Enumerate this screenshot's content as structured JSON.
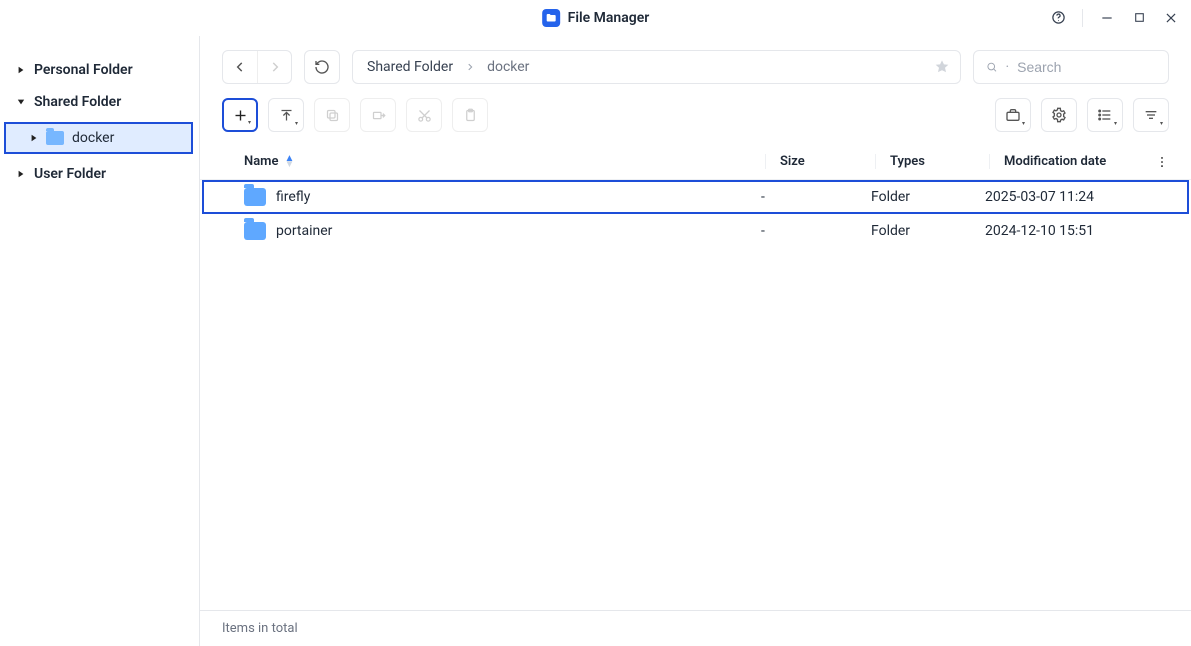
{
  "app": {
    "title": "File Manager"
  },
  "sidebar": {
    "items": [
      {
        "label": "Personal Folder",
        "expanded": false
      },
      {
        "label": "Shared Folder",
        "expanded": true,
        "children": [
          {
            "label": "docker",
            "selected": true
          }
        ]
      },
      {
        "label": "User Folder",
        "expanded": false
      }
    ]
  },
  "breadcrumb": {
    "segments": [
      "Shared Folder",
      "docker"
    ]
  },
  "search": {
    "placeholder": "Search"
  },
  "columns": {
    "name": "Name",
    "size": "Size",
    "types": "Types",
    "mod": "Modification date"
  },
  "rows": [
    {
      "name": "firefly",
      "size": "-",
      "types": "Folder",
      "mod": "2025-03-07 11:24",
      "selected": true
    },
    {
      "name": "portainer",
      "size": "-",
      "types": "Folder",
      "mod": "2024-12-10 15:51",
      "selected": false
    }
  ],
  "status": {
    "text": "Items in total"
  },
  "icons": {
    "add": "add-icon",
    "upload": "upload-icon",
    "copy": "copy-icon",
    "move": "move-to-icon",
    "cut": "cut-icon",
    "paste": "paste-icon",
    "toolbox": "toolbox-icon",
    "settings": "settings-icon",
    "list": "list-view-icon",
    "sort": "sort-icon"
  }
}
